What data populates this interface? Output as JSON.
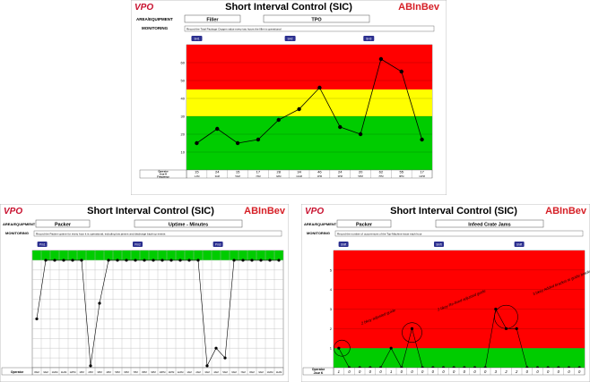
{
  "common": {
    "logo_text": "VPO",
    "brand_text": "ABInBev",
    "area_label": "AREA/EQUIPMENT",
    "monitoring_label": "MONITORING",
    "title": "Short Interval Control (SIC)",
    "colors": {
      "red": "#ff0000",
      "yellow": "#ffff00",
      "green": "#00cc00",
      "shift_tag": "#2b2f8f",
      "brand": "#d61f26"
    }
  },
  "chart_data": [
    {
      "type": "line",
      "equipment": "Filler",
      "metric": "TPO",
      "monitoring_text": "Record the Total Package Oxygen value every two hours the filler is operational",
      "shift_tags": [
        "SH1",
        "SH2",
        "SH3"
      ],
      "ylim": [
        0,
        70
      ],
      "yticks": [
        10,
        20,
        30,
        40,
        50,
        60
      ],
      "bands": [
        {
          "color": "green",
          "from": 0,
          "to": 30
        },
        {
          "color": "yellow",
          "from": 30,
          "to": 45
        },
        {
          "color": "red",
          "from": 45,
          "to": 70
        }
      ],
      "values": [
        15,
        23,
        15,
        17,
        28,
        34,
        46,
        24,
        20,
        62,
        55,
        17
      ],
      "table": {
        "row_labels": [
          "Operator",
          "Jour K",
          "Frequency"
        ],
        "values_row": [
          "15",
          "24",
          "15",
          "17",
          "28",
          "34",
          "46",
          "24",
          "20",
          "62",
          "55",
          "17"
        ],
        "time_row": [
          "1 AM",
          "3AM",
          "5AM",
          "7AM",
          "9AM",
          "11AM",
          "1PM",
          "3PM",
          "5PM",
          "7PM",
          "9PM",
          "11PM"
        ]
      }
    },
    {
      "type": "line",
      "equipment": "Packer",
      "metric": "Uptime - Minutes",
      "monitoring_text": "Record the Packer uptime for every hour it is operational, including low jamms and discharge back-up events",
      "shift_tags": [
        "Pm1",
        "Pm2",
        "Pm3"
      ],
      "ylim": [
        0,
        60
      ],
      "bands": [
        {
          "color": "green",
          "from": 55,
          "to": 60
        }
      ],
      "values": [
        25,
        55,
        55,
        55,
        55,
        55,
        1,
        33,
        55,
        55,
        55,
        55,
        55,
        55,
        55,
        55,
        55,
        55,
        55,
        1,
        10,
        5,
        55,
        55,
        55,
        55,
        55,
        55
      ],
      "table": {
        "row_labels": [
          "Operator"
        ],
        "time_row": [
          "8AM",
          "9AM",
          "10AM",
          "11AM",
          "12PM",
          "1PM",
          "2PM",
          "3PM",
          "4PM",
          "5PM",
          "6PM",
          "7PM",
          "8PM",
          "9PM",
          "10PM",
          "11PM",
          "12AM",
          "1AM",
          "2AM",
          "3AM",
          "4AM",
          "5AM",
          "6AM",
          "7AM",
          "8AM",
          "9AM",
          "10AM",
          "11AM"
        ]
      }
    },
    {
      "type": "line",
      "equipment": "Packer",
      "metric": "Infeed Crate Jams",
      "monitoring_text": "Record the number of occurrences of the Top-Machine issue each hour",
      "shift_tags": [
        "Shift",
        "Shift",
        "Shift"
      ],
      "ylim": [
        0,
        6
      ],
      "yticks": [
        1,
        2,
        3,
        4,
        5
      ],
      "bands": [
        {
          "color": "green",
          "from": 0,
          "to": 1
        },
        {
          "color": "red",
          "from": 1,
          "to": 6
        }
      ],
      "values": [
        1,
        0,
        0,
        0,
        0,
        1,
        0,
        2,
        0,
        0,
        0,
        0,
        0,
        0,
        0,
        3,
        2,
        2,
        0,
        0,
        0,
        0,
        0,
        0
      ],
      "table": {
        "row_labels": [
          "Operator",
          "Jour K"
        ],
        "values_row": [
          "1",
          "0",
          "0",
          "0",
          "0",
          "1",
          "0",
          "0",
          "0",
          "0",
          "0",
          "0",
          "0",
          "0",
          "0",
          "3",
          "2",
          "2",
          "0",
          "0",
          "0",
          "0",
          "0",
          "0"
        ]
      },
      "annotations": [
        "2 bkey adjusted guide",
        "2 bkey Re-fixed adjusted guide",
        "3 bkey Added bracket to guide bracket"
      ]
    }
  ]
}
